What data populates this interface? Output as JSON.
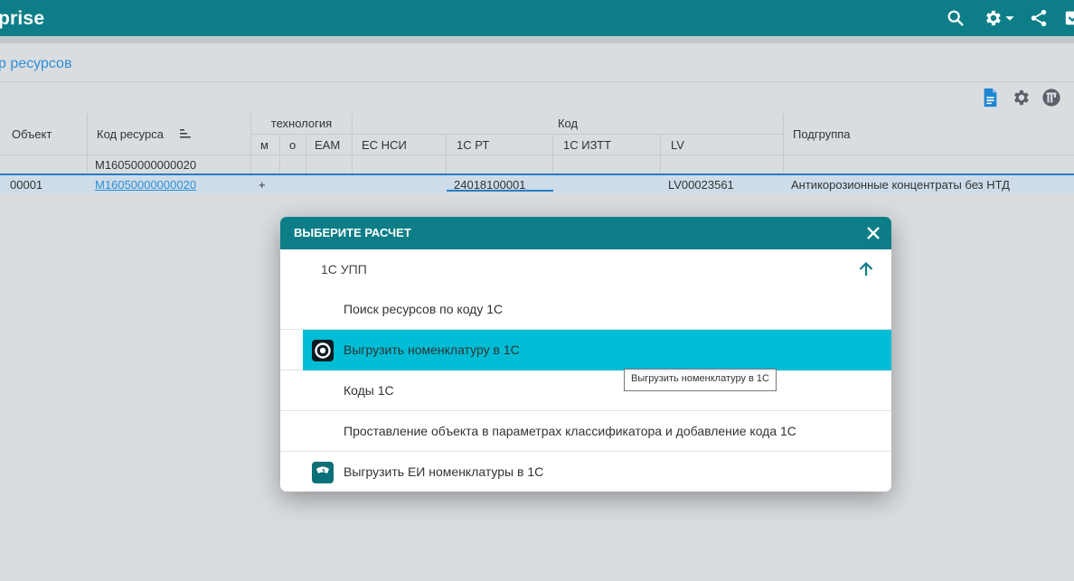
{
  "app": {
    "brand": "prise"
  },
  "page": {
    "title": "р ресурсов"
  },
  "table": {
    "headers": {
      "object": "Объект",
      "resource_code": "Код ресурса",
      "technology": "технология",
      "tech_m": "м",
      "tech_o": "о",
      "tech_eam": "EAM",
      "code": "Код",
      "code_ec_nsi": "ЕС НСИ",
      "code_1c_rt": "1С РТ",
      "code_1c_iztt": "1С ИЗТТ",
      "code_lv": "LV",
      "subgroup": "Подгруппа"
    },
    "filter": {
      "resource_code": "M16050000000020"
    },
    "row": {
      "object": "00001",
      "resource_code": "M16050000000020",
      "tech_m": "+",
      "code_1c_rt": "24018100001",
      "code_lv": "LV00023561",
      "subgroup": "Антикорозионные концентраты без НТД"
    }
  },
  "modal": {
    "title": "ВЫБЕРИТЕ РАСЧЕТ",
    "group_label": "1С УПП",
    "items": [
      {
        "label": "Поиск ресурсов по коду 1С",
        "icon": null
      },
      {
        "label": "Выгрузить номенклатуру в 1С",
        "icon": "target-icon",
        "active": true
      },
      {
        "label": "Коды 1С",
        "icon": null
      },
      {
        "label": "Проставление объекта в параметрах классификатора и добавление кода 1С",
        "icon": null
      },
      {
        "label": "Выгрузить ЕИ номенклатуры в 1С",
        "icon": "scale-icon"
      }
    ],
    "tooltip": "Выгрузить номенклатуру в 1С"
  },
  "colors": {
    "primary": "#0d7e87",
    "highlight": "#00bcd4",
    "link": "#2f8fd6",
    "page_bg": "#dadde0"
  }
}
